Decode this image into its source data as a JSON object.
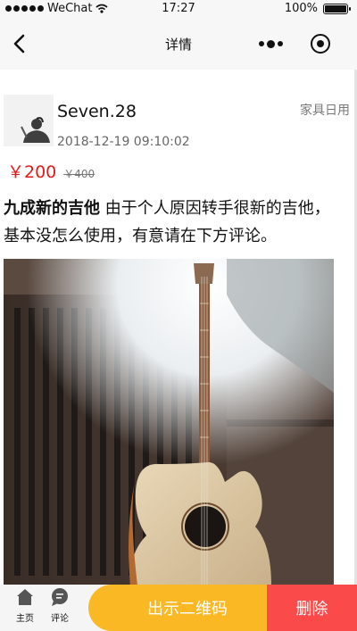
{
  "status_bar": {
    "carrier": "WeChat",
    "time": "17:27",
    "battery_text": "100%",
    "signal_icon": "signal-dots-icon",
    "wifi_icon": "wifi-icon",
    "battery_icon": "battery-icon",
    "battery_level": 1.0
  },
  "nav": {
    "title": "详情",
    "back_icon": "back-arrow-icon",
    "more_icon": "more-dots-icon",
    "close_icon": "target-circle-icon"
  },
  "post": {
    "username": "Seven.28",
    "category": "家具日用",
    "timestamp": "2018-12-19 09:10:02",
    "price": "￥200",
    "original_price": "￥400",
    "title": "九成新的吉他",
    "description": " 由于个人原因转手很新的吉他，基本没怎么使用，有意请在下方评论。",
    "image_subject": "acoustic-guitar-photo"
  },
  "bottom_bar": {
    "tabs": [
      {
        "label": "主页",
        "icon": "home-icon"
      },
      {
        "label": "评论",
        "icon": "comment-icon"
      }
    ],
    "qr_button": "出示二维码",
    "delete_button": "删除"
  },
  "colors": {
    "price": "#e21b1b",
    "qr_button": "#fbb825",
    "delete_button": "#fb4a4a",
    "bar_background": "#f7f7f7"
  }
}
